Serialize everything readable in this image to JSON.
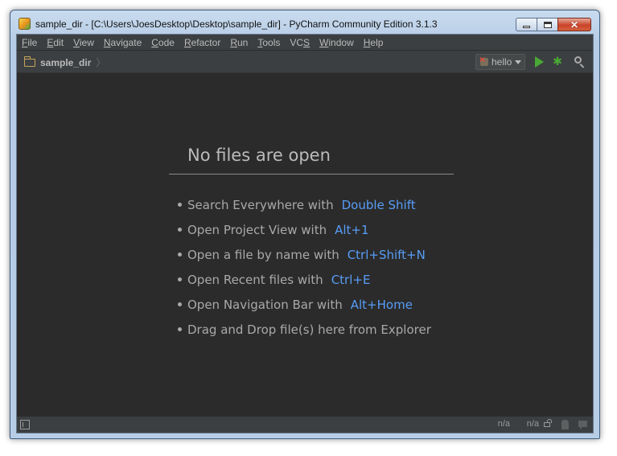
{
  "window": {
    "title": "sample_dir - [C:\\Users\\JoesDesktop\\Desktop\\sample_dir] - PyCharm Community Edition 3.1.3",
    "close_glyph": "✕"
  },
  "menu": [
    {
      "u": "F",
      "rest": "ile"
    },
    {
      "u": "E",
      "rest": "dit"
    },
    {
      "u": "V",
      "rest": "iew"
    },
    {
      "u": "N",
      "rest": "avigate"
    },
    {
      "u": "C",
      "rest": "ode"
    },
    {
      "u": "R",
      "rest": "efactor"
    },
    {
      "u": "R",
      "rest": "un"
    },
    {
      "u": "T",
      "rest": "ools"
    },
    {
      "pre": "VC",
      "u": "S",
      "rest": ""
    },
    {
      "u": "W",
      "rest": "indow"
    },
    {
      "u": "H",
      "rest": "elp"
    }
  ],
  "navbar": {
    "breadcrumb": "sample_dir",
    "separator": "〉",
    "run_config": "hello",
    "debug_glyph": "✱"
  },
  "editor": {
    "empty_title": "No files are open",
    "hints": [
      {
        "text": "Search Everywhere with",
        "shortcut": "Double Shift"
      },
      {
        "text": "Open Project View with",
        "shortcut": "Alt+1"
      },
      {
        "text": "Open a file by name with",
        "shortcut": "Ctrl+Shift+N"
      },
      {
        "text": "Open Recent files with",
        "shortcut": "Ctrl+E"
      },
      {
        "text": "Open Navigation Bar with",
        "shortcut": "Alt+Home"
      },
      {
        "text": "Drag and Drop file(s) here from Explorer",
        "shortcut": ""
      }
    ]
  },
  "status": {
    "position": "n/a",
    "encoding": "n/a"
  },
  "colors": {
    "background": "#2b2b2b",
    "panel": "#3c3f41",
    "text": "#bbbbbb",
    "shortcut": "#589df6",
    "run_green": "#49a835"
  },
  "icons": [
    "app-icon",
    "folder-icon",
    "python-icon",
    "run-icon",
    "debug-icon",
    "search-icon",
    "tool-window-toggle-icon",
    "lock-icon",
    "inspector-icon",
    "event-log-icon"
  ]
}
